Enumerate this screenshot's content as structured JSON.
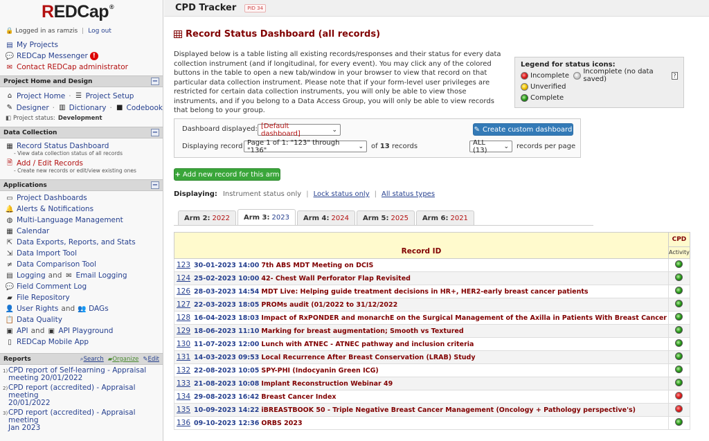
{
  "app": {
    "logo": "REDCap",
    "logo_sup": "®"
  },
  "user": {
    "logged_prefix": "Logged in as",
    "username": "ramzis",
    "logout": "Log out"
  },
  "top_links": [
    {
      "label": "My Projects",
      "icon": "projects-icon"
    },
    {
      "label": "REDCap Messenger",
      "icon": "messenger-icon",
      "badge": "!"
    },
    {
      "label": "Contact REDCap administrator",
      "icon": "mail-icon"
    }
  ],
  "sections": {
    "home": {
      "title": "Project Home and Design",
      "project_home": "Project Home",
      "project_setup": "Project Setup",
      "designer": "Designer",
      "dictionary": "Dictionary",
      "codebook": "Codebook",
      "status_label": "Project status:",
      "status_value": "Development"
    },
    "data_collection": {
      "title": "Data Collection",
      "record_status": "Record Status Dashboard",
      "record_status_note": "- View data collection status of all records",
      "add_edit": "Add / Edit Records",
      "add_edit_note": "- Create new records or edit/view existing ones"
    },
    "applications": {
      "title": "Applications",
      "items": [
        "Project Dashboards",
        "Alerts & Notifications",
        "Multi-Language Management",
        "Calendar",
        "Data Exports, Reports, and Stats",
        "Data Import Tool",
        "Data Comparison Tool"
      ],
      "logging": "Logging",
      "and": "and",
      "email_logging": "Email Logging",
      "field_comment_log": "Field Comment Log",
      "file_repository": "File Repository",
      "user_rights": "User Rights",
      "dags": "DAGs",
      "data_quality": "Data Quality",
      "api": "API",
      "api_playground": "API Playground",
      "mobile_app": "REDCap Mobile App"
    },
    "reports": {
      "title": "Reports",
      "search": "Search",
      "organize": "Organize",
      "edit": "Edit",
      "items": [
        {
          "num": "1)",
          "line1": "CPD report of Self-learning - Appraisal",
          "line2": "meeting 20/01/2022"
        },
        {
          "num": "2)",
          "line1": "CPD report (accredited) - Appraisal meeting",
          "line2": "20/01/2022"
        },
        {
          "num": "3)",
          "line1": "CPD report (accredited) - Appraisal meeting",
          "line2": "Jan 2023"
        }
      ]
    }
  },
  "header": {
    "project_title": "CPD Tracker",
    "pid": "PID 34"
  },
  "page": {
    "title": "Record Status Dashboard (all records)",
    "description": "Displayed below is a table listing all existing records/responses and their status for every data collection instrument (and if longitudinal, for every event). You may click any of the colored buttons in the table to open a new tab/window in your browser to view that record on that particular data collection instrument. Please note that if your form-level user privileges are restricted for certain data collection instruments, you will only be able to view those instruments, and if you belong to a Data Access Group, you will only be able to view records that belong to your group."
  },
  "legend": {
    "title": "Legend for status icons:",
    "incomplete": "Incomplete",
    "incomplete_nodata": "Incomplete (no data saved)",
    "help": "?",
    "unverified": "Unverified",
    "complete": "Complete"
  },
  "controls": {
    "dashboard_label": "Dashboard displayed:",
    "dashboard_value": "[Default dashboard]",
    "create_btn": "Create custom dashboard",
    "displaying_label": "Displaying record",
    "page_value": "Page 1 of 1: \"123\" through \"136\"",
    "of_prefix": "of",
    "total_records": "13",
    "records_word": "records",
    "per_page_value": "ALL (13)",
    "per_page_label": "records per page",
    "add_new": "Add new record for this arm"
  },
  "displaying": {
    "label": "Displaying:",
    "current": "Instrument status only",
    "lock": "Lock status only",
    "all": "All status types"
  },
  "tabs": [
    {
      "arm": "Arm 2:",
      "year": "2022",
      "active": false
    },
    {
      "arm": "Arm 3:",
      "year": "2023",
      "active": true
    },
    {
      "arm": "Arm 4:",
      "year": "2024",
      "active": false
    },
    {
      "arm": "Arm 5:",
      "year": "2025",
      "active": false
    },
    {
      "arm": "Arm 6:",
      "year": "2021",
      "active": false
    }
  ],
  "table": {
    "col_record": "Record ID",
    "col_cpd": "CPD",
    "col_activity": "Activity",
    "rows": [
      {
        "id": "123",
        "date": "30-01-2023 14:00",
        "title": "7th ABS MDT Meeting on DCIS",
        "status": "green"
      },
      {
        "id": "124",
        "date": "25-02-2023 10:00",
        "title": "42- Chest Wall Perforator Flap Revisited",
        "status": "green"
      },
      {
        "id": "126",
        "date": "28-03-2023 14:54",
        "title": "MDT Live: Helping guide treatment decisions in HR+, HER2-early breast cancer patients",
        "status": "green"
      },
      {
        "id": "127",
        "date": "22-03-2023 18:05",
        "title": "PROMs audit (01/2022 to 31/12/2022",
        "status": "green"
      },
      {
        "id": "128",
        "date": "16-04-2023 18:03",
        "title": "Impact of RxPONDER and monarchE on the Surgical Management of the Axilla in Patients With Breast Cancer",
        "status": "green"
      },
      {
        "id": "129",
        "date": "18-06-2023 11:10",
        "title": "Marking for breast augmentation; Smooth vs Textured",
        "status": "green"
      },
      {
        "id": "130",
        "date": "11-07-2023 12:00",
        "title": "Lunch with ATNEC - ATNEC pathway and inclusion criteria",
        "status": "green"
      },
      {
        "id": "131",
        "date": "14-03-2023 09:53",
        "title": "Local Recurrence After Breast Conservation (LRAB) Study",
        "status": "green"
      },
      {
        "id": "132",
        "date": "22-08-2023 10:05",
        "title": "SPY-PHI (Indocyanin Green ICG)",
        "status": "green"
      },
      {
        "id": "133",
        "date": "21-08-2023 10:08",
        "title": "Implant Reconstruction Webinar 49",
        "status": "green"
      },
      {
        "id": "134",
        "date": "29-08-2023 16:42",
        "title": "Breast Cancer Index",
        "status": "red"
      },
      {
        "id": "135",
        "date": "10-09-2023 14:22",
        "title": "iBREASTBOOK 50 - Triple Negative Breast Cancer Management (Oncology + Pathology perspective's)",
        "status": "red"
      },
      {
        "id": "136",
        "date": "09-10-2023 12:36",
        "title": "ORBS 2023",
        "status": "green"
      }
    ]
  }
}
